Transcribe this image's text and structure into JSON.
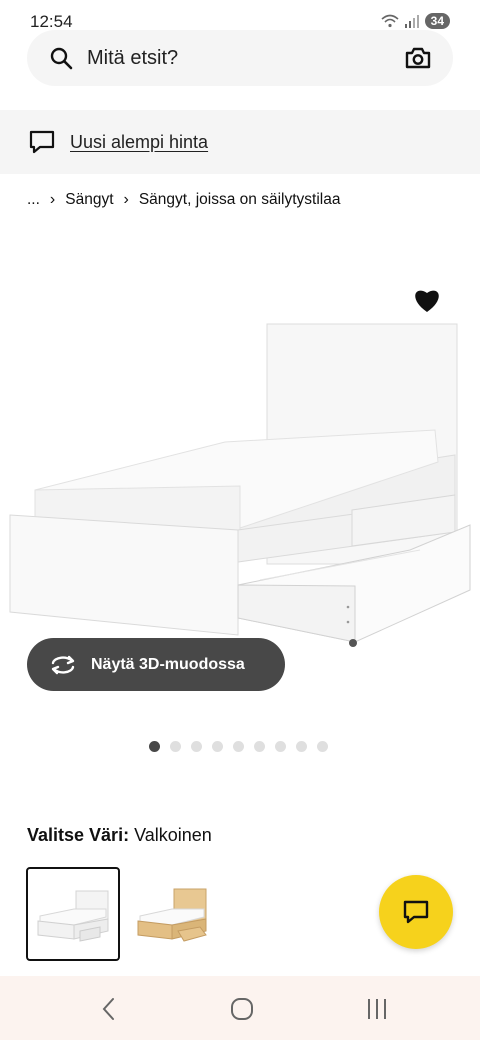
{
  "status": {
    "time": "12:54",
    "battery": "34"
  },
  "search": {
    "placeholder": "Mitä etsit?"
  },
  "promo": {
    "text": "Uusi alempi hinta"
  },
  "breadcrumb": {
    "items": [
      "...",
      "Sängyt",
      "Sängyt, joissa on säilytystilaa"
    ]
  },
  "product": {
    "view3d_label": "Näytä 3D-muodossa",
    "image_count": 9,
    "active_image_index": 0
  },
  "color": {
    "label": "Valitse Väri:",
    "value": "Valkoinen"
  },
  "icons": {
    "search": "search-icon",
    "camera": "camera-icon",
    "chat": "chat-bubble-icon",
    "favourite": "heart-icon",
    "rotate": "rotate-3d-icon",
    "back": "back-icon",
    "home": "home-icon",
    "recents": "recents-icon"
  },
  "colors": {
    "accent": "#f6d21c",
    "dark_button": "#484848",
    "banner_bg": "#f5f5f5"
  }
}
